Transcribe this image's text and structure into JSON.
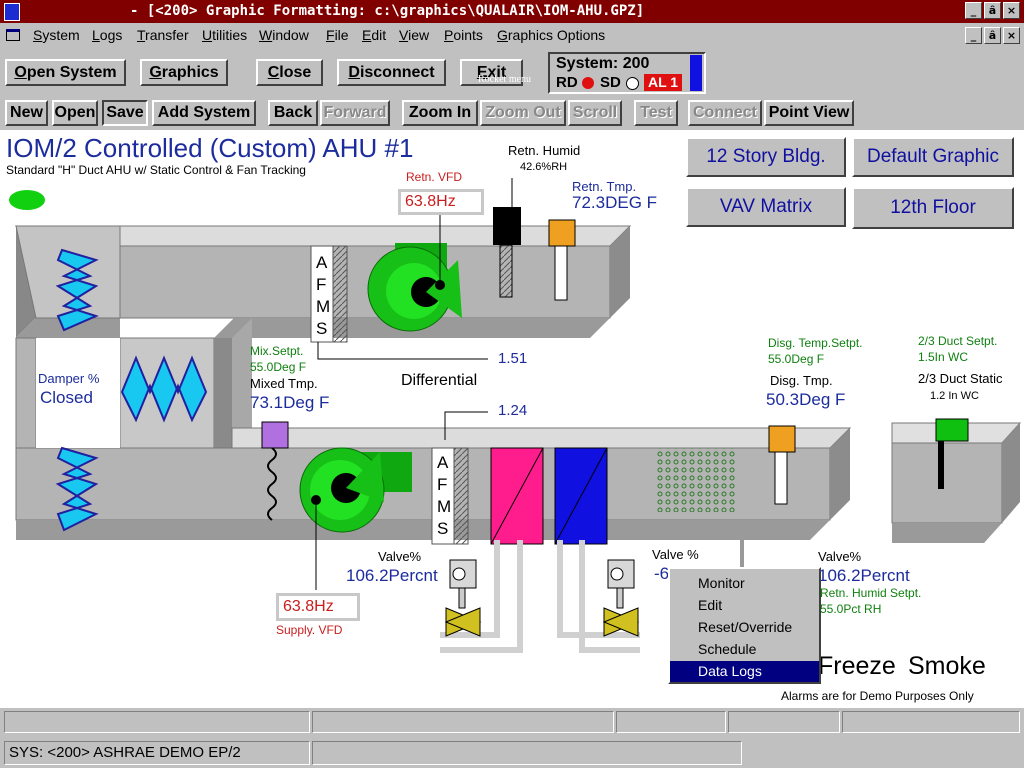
{
  "window": {
    "title": "- [<200> Graphic Formatting: c:\\graphics\\QUALAIR\\IOM-AHU.GPZ]",
    "min": "_",
    "max": "ȃ",
    "close": "×"
  },
  "menu": [
    "System",
    "Logs",
    "Transfer",
    "Utilities",
    "Window",
    "File",
    "Edit",
    "View",
    "Points",
    "Graphics Options"
  ],
  "toolbar1": [
    "Open System",
    "Graphics",
    "Close",
    "Disconnect",
    "Exit"
  ],
  "toolbar_tooltip": "Rocket menu",
  "system_panel": {
    "label": "System: 200",
    "rd": "RD",
    "sd": "SD",
    "alarm": "AL 1"
  },
  "toolbar2": [
    "New",
    "Open",
    "Save",
    "Add System",
    "Back",
    "Forward",
    "Zoom In",
    "Zoom Out",
    "Scroll",
    "Test",
    "Connect",
    "Point View"
  ],
  "graphic": {
    "title": "IOM/2 Controlled (Custom) AHU #1",
    "subtitle": "Standard \"H\" Duct AHU w/ Static Control & Fan Tracking",
    "nav_buttons": [
      "12 Story Bldg.",
      "Default Graphic",
      "VAV Matrix",
      "12th Floor"
    ],
    "retn_vfd_label": "Retn. VFD",
    "retn_vfd_value": "63.8Hz",
    "retn_humid_label": "Retn. Humid",
    "retn_humid_value": "42.6%RH",
    "retn_tmp_label": "Retn. Tmp.",
    "retn_tmp_value": "72.3DEG F",
    "afms": [
      "A",
      "F",
      "M",
      "S"
    ],
    "damper_label": "Damper %",
    "damper_value": "Closed",
    "mix_setpt_label": "Mix.Setpt.",
    "mix_setpt_value": "55.0Deg F",
    "mixed_tmp_label": "Mixed Tmp.",
    "mixed_tmp_value": "73.1Deg F",
    "diff_upper": "1.51",
    "diff_label": "Differential",
    "diff_lower": "1.24",
    "disg_setpt_label": "Disg. Temp.Setpt.",
    "disg_setpt_value": "55.0Deg F",
    "disg_tmp_label": "Disg. Tmp.",
    "disg_tmp_value": "50.3Deg F",
    "duct_setpt_label": "2/3 Duct Setpt.",
    "duct_setpt_value": "1.5In WC",
    "duct_static_label": "2/3 Duct Static",
    "duct_static_value": "1.2 In WC",
    "valve1_label": "Valve%",
    "valve1_value": "106.2Percnt",
    "valve2_label": "Valve %",
    "valve2_value": "-6.",
    "valve3_label": "Valve%",
    "valve3_value": "106.2Percnt",
    "retn_humid_setpt_label": "Retn. Humid Setpt.",
    "retn_humid_setpt_value": "55.0Pct RH",
    "supply_vfd_label": "Supply. VFD",
    "supply_vfd_value": "63.8Hz",
    "freeze": "Freeze",
    "smoke": "Smoke",
    "alarm_note": "Alarms are for Demo Purposes Only"
  },
  "context_menu": [
    "Monitor",
    "Edit",
    "Reset/Override",
    "Schedule",
    "Data Logs"
  ],
  "status_bar": {
    "sys": "SYS: <200> ASHRAE DEMO EP/2"
  },
  "colors": {
    "title_bg": "#800000",
    "fan": "#16c016",
    "duct": "#b0b0b0",
    "heat_coil": "#ff1c8c",
    "cool_coil": "#1010e0",
    "label_red": "#c81e1e",
    "label_green": "#108010",
    "value_blue": "#1c2c9c",
    "menu_select": "#000080"
  }
}
